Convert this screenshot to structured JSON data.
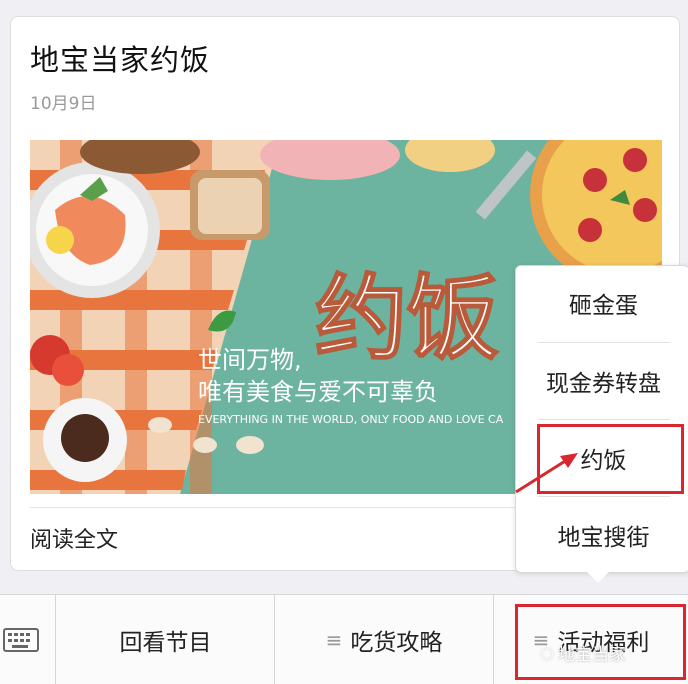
{
  "article": {
    "title": "地宝当家约饭",
    "date": "10月9日",
    "read_more": "阅读全文",
    "banner": {
      "headline": "约饭",
      "slogan_line1": "世间万物,",
      "slogan_line2": "唯有美食与爱不可辜负",
      "english": "EVERYTHING IN THE WORLD, ONLY FOOD AND LOVE CA"
    }
  },
  "popup_menu": {
    "items": [
      {
        "label": "砸金蛋"
      },
      {
        "label": "现金券转盘"
      },
      {
        "label": "约饭"
      },
      {
        "label": "地宝搜街"
      }
    ]
  },
  "bottom_menu": {
    "keyboard_icon": "keyboard-icon",
    "tabs": [
      {
        "label": "回看节目"
      },
      {
        "label": "吃货攻略"
      },
      {
        "label": "活动福利"
      }
    ]
  },
  "watermark": {
    "label": "地宝当家"
  },
  "colors": {
    "highlight": "#d9272f",
    "banner_bg": "#6fb6a2"
  }
}
